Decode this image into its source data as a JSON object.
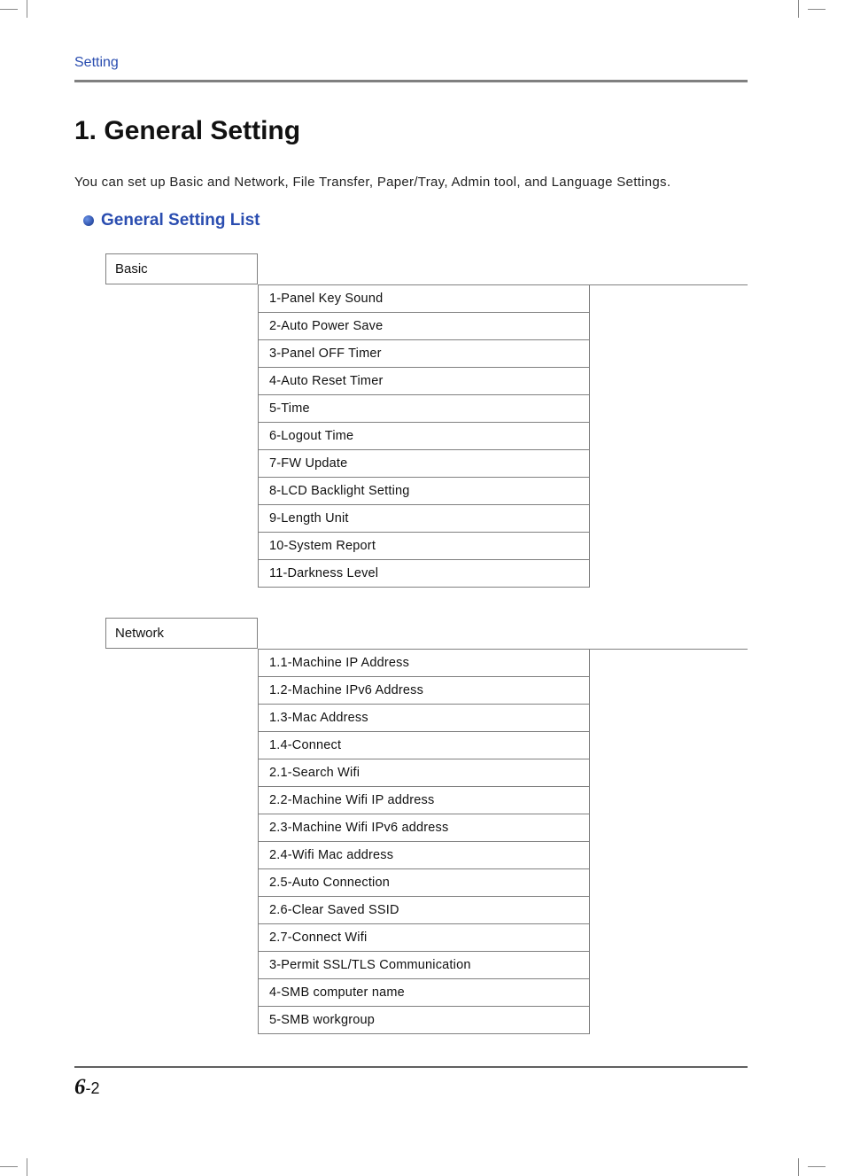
{
  "header": {
    "section": "Setting"
  },
  "heading": "1. General Setting",
  "intro": "You can set up Basic and Network, File Transfer, Paper/Tray, Admin tool, and Language Settings.",
  "subheading": "General Setting List",
  "groups": [
    {
      "label": "Basic",
      "items": [
        "1-Panel Key Sound",
        "2-Auto Power Save",
        "3-Panel OFF Timer",
        "4-Auto Reset Timer",
        "5-Time",
        "6-Logout Time",
        "7-FW Update",
        "8-LCD Backlight Setting",
        "9-Length Unit",
        "10-System Report",
        "11-Darkness Level"
      ]
    },
    {
      "label": "Network",
      "items": [
        "1.1-Machine IP Address",
        "1.2-Machine IPv6 Address",
        "1.3-Mac Address",
        "1.4-Connect",
        "2.1-Search Wifi",
        "2.2-Machine Wifi IP address",
        "2.3-Machine Wifi IPv6 address",
        "2.4-Wifi Mac address",
        "2.5-Auto Connection",
        "2.6-Clear Saved SSID",
        "2.7-Connect Wifi",
        "3-Permit SSL/TLS Communication",
        "4-SMB computer name",
        "5-SMB workgroup"
      ]
    }
  ],
  "footer": {
    "chapter": "6",
    "page": "-2"
  }
}
